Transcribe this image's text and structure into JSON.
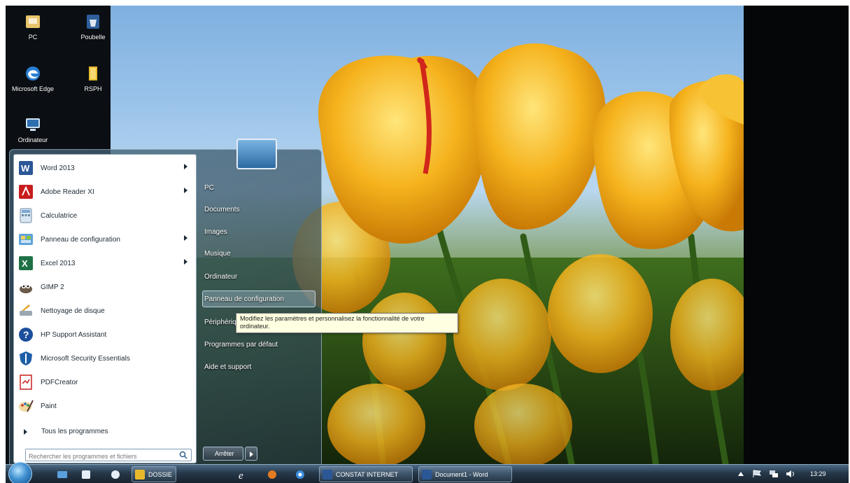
{
  "desktop_icons": [
    {
      "label": "PC",
      "icon": "computer-folder-icon"
    },
    {
      "label": "Poubelle",
      "icon": "recycle-bin-icon"
    },
    {
      "label": "Microsoft Edge",
      "icon": "edge-icon"
    },
    {
      "label": "RSPH",
      "icon": "folder-icon"
    },
    {
      "label": "Ordinateur",
      "icon": "computer-icon"
    }
  ],
  "start_menu": {
    "programs": [
      {
        "label": "Word 2013",
        "icon": "word-icon",
        "has_submenu": true
      },
      {
        "label": "Adobe Reader XI",
        "icon": "adobe-reader-icon",
        "has_submenu": true
      },
      {
        "label": "Calculatrice",
        "icon": "calculator-icon",
        "has_submenu": false
      },
      {
        "label": "Panneau de configuration",
        "icon": "control-panel-icon",
        "has_submenu": true
      },
      {
        "label": "Excel 2013",
        "icon": "excel-icon",
        "has_submenu": true
      },
      {
        "label": "GIMP 2",
        "icon": "gimp-icon",
        "has_submenu": false
      },
      {
        "label": "Nettoyage de disque",
        "icon": "disk-cleanup-icon",
        "has_submenu": false
      },
      {
        "label": "HP Support Assistant",
        "icon": "help-icon",
        "has_submenu": false
      },
      {
        "label": "Microsoft Security Essentials",
        "icon": "security-essentials-icon",
        "has_submenu": false
      },
      {
        "label": "PDFCreator",
        "icon": "pdfcreator-icon",
        "has_submenu": false
      },
      {
        "label": "Paint",
        "icon": "paint-icon",
        "has_submenu": false
      }
    ],
    "all_programs": "Tous les programmes",
    "search_placeholder": "Rechercher les programmes et fichiers",
    "places": [
      "PC",
      "Documents",
      "Images",
      "Musique",
      "Ordinateur",
      "Panneau de configuration",
      "Périphériques",
      "Programmes par défaut",
      "Aide et support"
    ],
    "highlighted_place": "Panneau de configuration",
    "shutdown_label": "Arrêter",
    "tooltip": "Modifiez les paramètres et personnalisez la fonctionnalité de votre ordinateur."
  },
  "taskbar": {
    "tasks": [
      {
        "label": "DOSSIE",
        "icon": "folder-icon",
        "color": "#e8b92a"
      },
      {
        "label": "CONSTAT INTERNET",
        "icon": "word-icon",
        "color": "#2b5797"
      },
      {
        "label": "Document1 - Word",
        "icon": "word-icon",
        "color": "#2b5797"
      }
    ],
    "clock": "13:29"
  }
}
